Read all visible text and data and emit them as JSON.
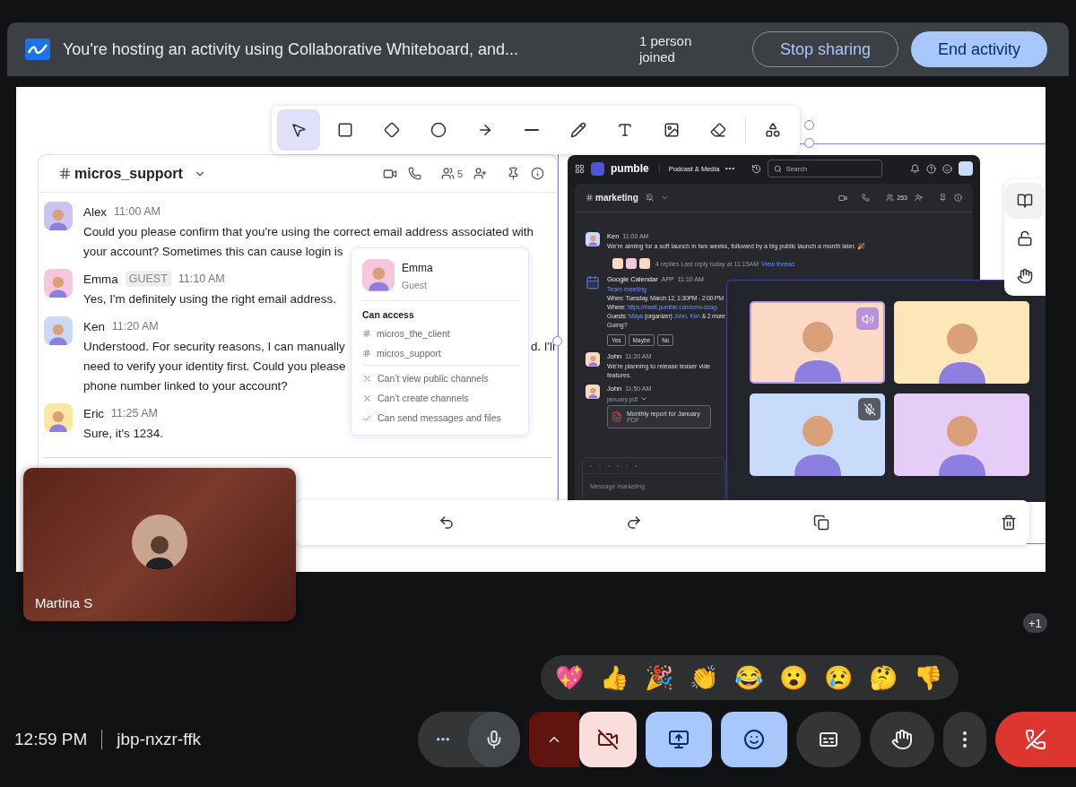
{
  "banner": {
    "message": "You're hosting an activity using Collaborative Whiteboard, and...",
    "status": "1 person joined",
    "buttons": [
      {
        "label": "Stop sharing",
        "kind": "outline"
      },
      {
        "label": "End activity",
        "kind": "primary"
      }
    ]
  },
  "whiteboard": {
    "tools": [
      {
        "kind": "select",
        "selected": true
      },
      {
        "kind": "rectangle",
        "selected": false
      },
      {
        "kind": "diamond",
        "selected": false
      },
      {
        "kind": "circle",
        "selected": false
      },
      {
        "kind": "arrow",
        "selected": false
      },
      {
        "kind": "line",
        "selected": false
      },
      {
        "kind": "pen",
        "selected": false
      },
      {
        "kind": "text",
        "selected": false
      },
      {
        "kind": "image",
        "selected": false
      },
      {
        "kind": "eraser",
        "selected": false
      },
      {
        "kind": "shapes",
        "selected": false
      }
    ],
    "chat": {
      "channel": "micros_support",
      "member_count": "5",
      "messages": [
        {
          "author": "Alex",
          "time": "11:00 AM",
          "color": "#c9c4f2",
          "lines": [
            {
              "text": "Could you please confirm that you're using the correct email address associated with"
            },
            {
              "text": "your account? Sometimes this can cause login is"
            }
          ]
        },
        {
          "author": "Emma",
          "badge": "GUEST",
          "time": "11:10 AM",
          "color": "#f6c6dd",
          "lines": [
            {
              "text": "Yes, I'm definitely using the right email address."
            }
          ]
        },
        {
          "author": "Ken",
          "time": "11:20 AM",
          "color": "#c9d9f7",
          "lines": [
            {
              "text": "Understood. For security reasons, I can manually",
              "tail": "d. I'll"
            },
            {
              "text": "need to verify your identity first. Could you please"
            },
            {
              "text": "phone number linked to your account?"
            }
          ]
        },
        {
          "author": "Eric",
          "time": "11:25 AM",
          "color": "#fbe6a2",
          "lines": [
            {
              "text": "Sure, it's 1234."
            }
          ]
        }
      ]
    },
    "profile_card": {
      "name": "Emma",
      "role": "Guest",
      "section": "Can access",
      "channels": [
        "micros_the_client",
        "micros_support"
      ],
      "permissions": [
        {
          "text": "Can’t view public channels",
          "allowed": false
        },
        {
          "text": "Can’t create channels",
          "allowed": false
        },
        {
          "text": "Can send messages and files",
          "allowed": true
        }
      ]
    },
    "pumble": {
      "app_name": "pumble",
      "workspace": "Podcast & Media",
      "search_placeholder": "Search",
      "channel": "marketing",
      "member_count": "253",
      "composer_placeholder": "Message marketing",
      "messages": [
        {
          "kind": "text",
          "author": "Ken",
          "time": "11:00 AM",
          "color": "#c9d9f7",
          "lines": [
            "We're aiming for a soft launch in two weeks, followed by a big public launch a month later. 🎉"
          ],
          "thread": {
            "summary": "4 replies  Last reply today at 11:15AM",
            "link": "View thread"
          }
        },
        {
          "kind": "event",
          "author": "Google Calendar",
          "tag": "APP",
          "time": "11:10 AM",
          "color": "#4a72d9",
          "title": "Team meeting",
          "when_label": "When:",
          "when": "Tuesday, March 12, 1:30PM - 2:00 PM",
          "where_label": "Where:",
          "where": "https://meet.pumble.com/cmv-ssog-",
          "guests_label": "Guests:",
          "guests": [
            {
              "text": "Maya",
              "link": true
            },
            {
              "text": "(organizer)",
              "link": false
            },
            {
              "text": "John,",
              "link": true
            },
            {
              "text": "Ken",
              "link": true
            },
            {
              "text": "& 2 more",
              "link": false
            }
          ],
          "question": "Going?",
          "options": [
            "Yes",
            "Maybe",
            "No"
          ]
        },
        {
          "kind": "text",
          "author": "John",
          "time": "11:20 AM",
          "color": "#fcd9c4",
          "lines": [
            "We're planning to release teaser vide",
            "features."
          ]
        },
        {
          "kind": "file",
          "author": "John",
          "time": "11:50 AM",
          "color": "#fcd9c4",
          "file_name": "january.pdf",
          "attachment": "Monthly report for January",
          "attachment_type": "PDF"
        }
      ]
    },
    "call": {
      "tiles": [
        {
          "color": "#fcd9c4",
          "kind": "speaking"
        },
        {
          "color": "#fde7b8",
          "kind": "plain"
        },
        {
          "color": "#c9dbfb",
          "kind": "muted"
        },
        {
          "color": "#e6cdf7",
          "kind": "plain"
        }
      ]
    },
    "side_tools": [
      {
        "kind": "book",
        "selected": true
      },
      {
        "kind": "unlock",
        "selected": false
      },
      {
        "kind": "hand",
        "selected": false
      }
    ],
    "actions": [
      {
        "kind": "undo"
      },
      {
        "kind": "redo"
      },
      {
        "kind": "copy"
      },
      {
        "kind": "delete"
      }
    ]
  },
  "self_view": {
    "name": "Martina S"
  },
  "more_participants": "+1",
  "reactions": [
    "💖",
    "👍",
    "🎉",
    "👏",
    "😂",
    "😮",
    "😢",
    "🤔",
    "👎"
  ],
  "meeting": {
    "time": "12:59 PM",
    "code": "jbp-nxzr-ffk"
  },
  "controls": [
    {
      "kind": "more"
    },
    {
      "kind": "mic",
      "active": false
    },
    {
      "kind": "expand"
    },
    {
      "kind": "camera",
      "active": true
    },
    {
      "kind": "present",
      "active": true
    },
    {
      "kind": "reactions",
      "active": true
    },
    {
      "kind": "captions",
      "active": false
    },
    {
      "kind": "hand",
      "active": false
    },
    {
      "kind": "options"
    },
    {
      "kind": "leave"
    }
  ]
}
